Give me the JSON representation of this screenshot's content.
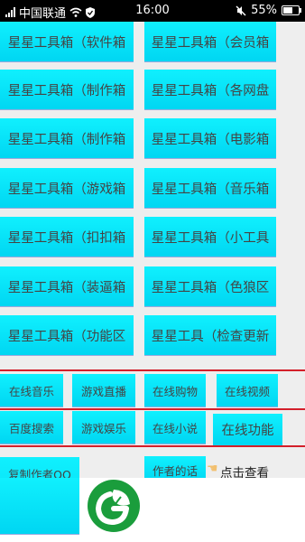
{
  "status_bar": {
    "carrier": "中国联通",
    "time": "16:00",
    "battery": "55%",
    "battery_level": 0.55
  },
  "grid": {
    "left": [
      "星星工具箱（软件箱",
      "星星工具箱（制作箱",
      "星星工具箱（制作箱",
      "星星工具箱（游戏箱",
      "星星工具箱（扣扣箱",
      "星星工具箱（装逼箱",
      "星星工具箱（功能区"
    ],
    "right": [
      "星星工具箱（会员箱",
      "星星工具箱（各网盘",
      "星星工具箱（电影箱",
      "星星工具箱（音乐箱",
      "星星工具箱（小工具",
      "星星工具箱（色狼区",
      "星星工具（检查更新"
    ]
  },
  "online_row1": [
    "在线音乐",
    "游戏直播",
    "在线购物",
    "在线视频"
  ],
  "online_row2": [
    "百度搜索",
    "游戏娱乐",
    "在线小说",
    "在线功能"
  ],
  "bottom": {
    "copy_author_qq": "复制作者QQ",
    "author_words": "作者的话",
    "click_view": "点击查看"
  },
  "icons": {
    "wifi": "wifi-icon",
    "shield": "shield-icon",
    "mute": "mute-icon",
    "hand": "pointing-hand-icon",
    "logo": "leaf-g-logo"
  }
}
